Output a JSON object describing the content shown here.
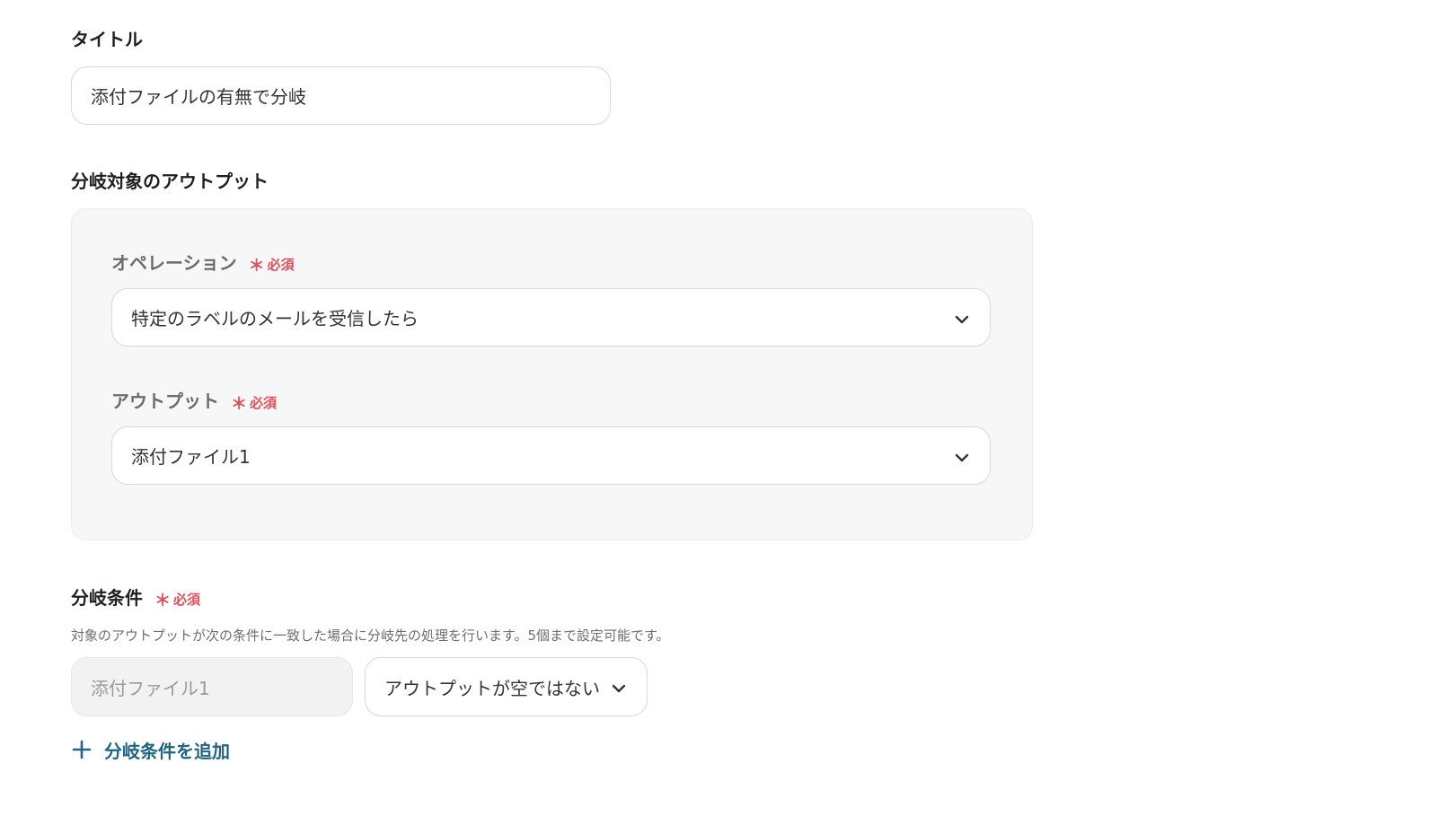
{
  "title_field": {
    "label": "タイトル",
    "value": "添付ファイルの有無で分岐"
  },
  "branch_target": {
    "label": "分岐対象のアウトプット",
    "operation": {
      "label": "オペレーション",
      "required_text": "必須",
      "value": "特定のラベルのメールを受信したら"
    },
    "output": {
      "label": "アウトプット",
      "required_text": "必須",
      "value": "添付ファイル1"
    }
  },
  "branch_conditions": {
    "label": "分岐条件",
    "required_text": "必須",
    "description": "対象のアウトプットが次の条件に一致した場合に分岐先の処理を行います。5個まで設定可能です。",
    "rows": [
      {
        "field_value": "添付ファイル1",
        "condition_value": "アウトプットが空ではない"
      }
    ],
    "add_label": "分岐条件を追加"
  },
  "colors": {
    "required": "#e0505a",
    "link": "#1f6583",
    "panel_bg": "#f7f7f7"
  }
}
